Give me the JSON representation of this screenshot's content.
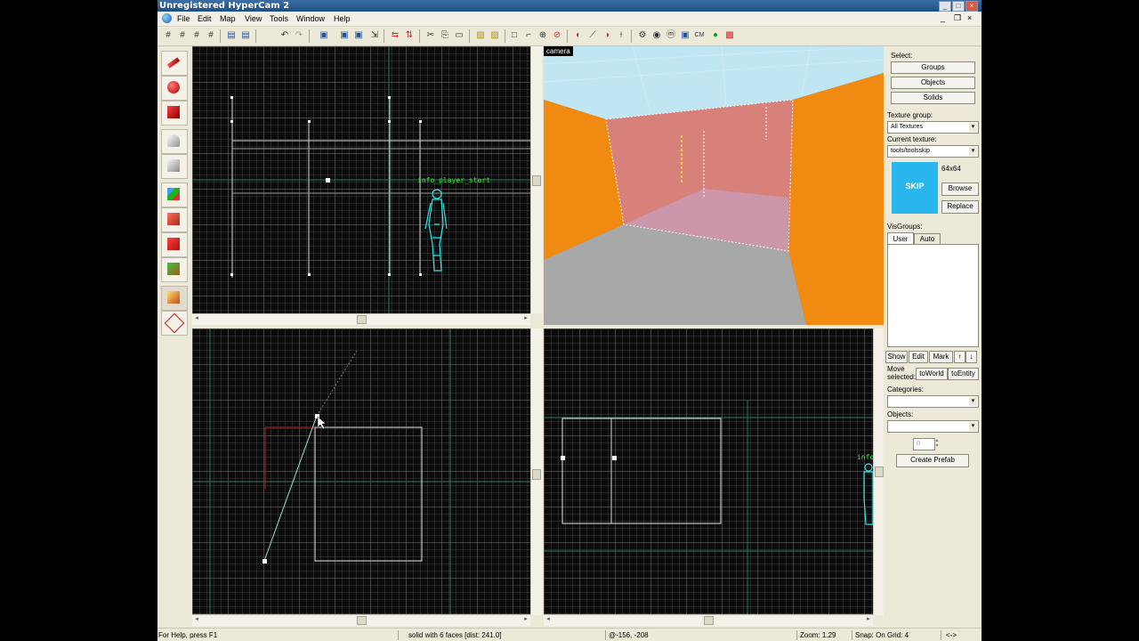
{
  "window": {
    "title": "Unregistered HyperCam 2"
  },
  "menu": [
    "File",
    "Edit",
    "Map",
    "View",
    "Tools",
    "Window",
    "Help"
  ],
  "viewports": {
    "camera_label": "camera",
    "entity_label_top": "info_player_start",
    "entity_label_side": "info_"
  },
  "texture_preview": {
    "name": "SKIP",
    "size": "64x64"
  },
  "panel": {
    "select_label": "Select:",
    "groups": "Groups",
    "objects": "Objects",
    "solids": "Solids",
    "texture_group_label": "Texture group:",
    "texture_group_value": "All Textures",
    "current_texture_label": "Current texture:",
    "current_texture_value": "tools/toolsskip",
    "browse": "Browse",
    "replace": "Replace",
    "visgroups_label": "VisGroups:",
    "tab_user": "User",
    "tab_auto": "Auto",
    "show": "Show",
    "edit": "Edit",
    "mark": "Mark",
    "move_selected_label": "Move selected:",
    "to_world": "toWorld",
    "to_entity": "toEntity",
    "categories_label": "Categories:",
    "objects_label": "Objects:",
    "spin_value": "0",
    "create_prefab": "Create Prefab"
  },
  "status": {
    "help": "For Help, press F1",
    "selection": "solid with 6 faces  [dist: 241.0]",
    "coords": "@-156, -208",
    "zoom": "Zoom: 1.29",
    "snap": "Snap: On Grid: 4",
    "extra": "<->"
  },
  "colors": {
    "wire_white": "#e6e6e6",
    "entity_cyan": "#2fe6e0",
    "entity_label_green": "#39e639",
    "wall_orange": "#f08a10",
    "texture_skip_bg": "#29b6ec"
  },
  "icons": {
    "toolbar": [
      "grid-icon",
      "undo-icon",
      "redo-icon",
      "cut-icon",
      "copy-icon",
      "paste-icon",
      "carve-icon",
      "texture-lock-icon",
      "run-map-icon"
    ],
    "tools": [
      "selection-tool-icon",
      "magnify-tool-icon",
      "camera-tool-icon",
      "entity-tool-icon",
      "block-tool-icon",
      "texture-tool-icon",
      "apply-texture-icon",
      "decal-tool-icon",
      "overlay-tool-icon",
      "clip-tool-icon",
      "vertex-tool-icon"
    ]
  }
}
